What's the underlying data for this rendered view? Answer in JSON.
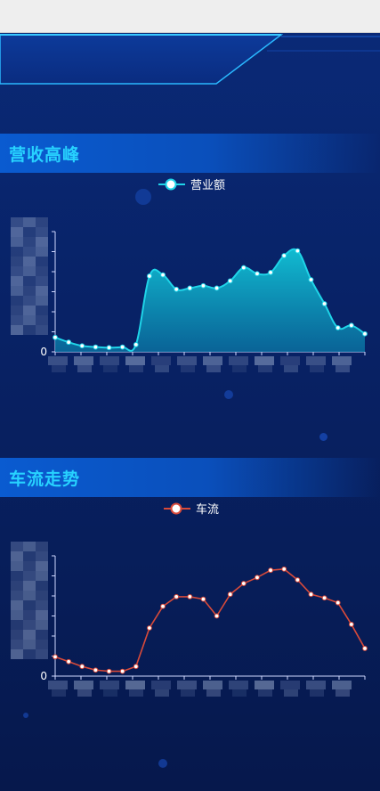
{
  "sections": [
    {
      "title": "营收高峰"
    },
    {
      "title": "车流走势"
    }
  ],
  "chart_data": [
    {
      "type": "area",
      "title": "营收高峰",
      "series": [
        {
          "name": "营业额",
          "values": [
            12,
            8,
            5,
            4,
            3.5,
            4,
            6,
            63,
            64,
            52,
            53,
            55,
            53,
            59,
            70,
            65,
            66,
            80,
            84,
            60,
            40,
            20,
            22,
            15
          ],
          "color": "#1fd4e8"
        }
      ],
      "y_axis": {
        "min": 0,
        "max": 100,
        "zero_label": "0"
      },
      "x_labels_obscured": true
    },
    {
      "type": "line",
      "title": "车流走势",
      "series": [
        {
          "name": "车流",
          "values": [
            16,
            12,
            8,
            5,
            4,
            4,
            8,
            40,
            58,
            66,
            66,
            64,
            50,
            68,
            77,
            82,
            88,
            89,
            80,
            68,
            65,
            61,
            43,
            23
          ],
          "color": "#d84a3a"
        }
      ],
      "y_axis": {
        "min": 0,
        "max": 100,
        "zero_label": "0"
      },
      "x_labels_obscured": true
    }
  ]
}
